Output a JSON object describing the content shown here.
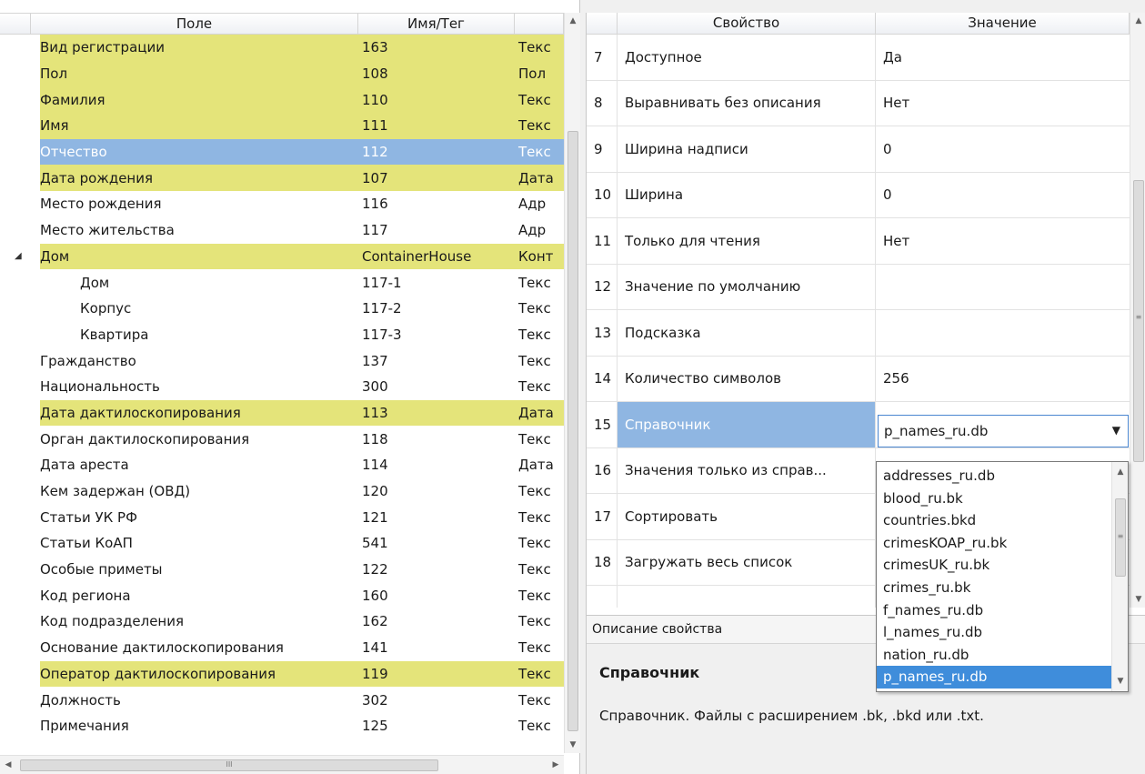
{
  "fields_panel": {
    "columns": [
      "Поле",
      "Имя/Тег",
      ""
    ],
    "rows": [
      {
        "field": "Вид регистрации",
        "tag": "163",
        "type": "Текс",
        "highlight": true,
        "level": 0
      },
      {
        "field": "Пол",
        "tag": "108",
        "type": "Пол",
        "highlight": true,
        "level": 0
      },
      {
        "field": "Фамилия",
        "tag": "110",
        "type": "Текс",
        "highlight": true,
        "level": 0
      },
      {
        "field": "Имя",
        "tag": "111",
        "type": "Текс",
        "highlight": true,
        "level": 0
      },
      {
        "field": "Отчество",
        "tag": "112",
        "type": "Текс",
        "selected": true,
        "level": 0
      },
      {
        "field": "Дата рождения",
        "tag": "107",
        "type": "Дата",
        "highlight": true,
        "level": 0
      },
      {
        "field": "Место рождения",
        "tag": "116",
        "type": "Адр",
        "level": 0
      },
      {
        "field": "Место жительства",
        "tag": "117",
        "type": "Адр",
        "level": 0
      },
      {
        "field": "Дом",
        "tag": "ContainerHouse",
        "type": "Конт",
        "highlight": true,
        "level": 0,
        "expanded": true
      },
      {
        "field": "Дом",
        "tag": "117-1",
        "type": "Текс",
        "level": 1
      },
      {
        "field": "Корпус",
        "tag": "117-2",
        "type": "Текс",
        "level": 1
      },
      {
        "field": "Квартира",
        "tag": "117-3",
        "type": "Текс",
        "level": 1
      },
      {
        "field": "Гражданство",
        "tag": "137",
        "type": "Текс",
        "level": 0
      },
      {
        "field": "Национальность",
        "tag": "300",
        "type": "Текс",
        "level": 0
      },
      {
        "field": "Дата дактилоскопирования",
        "tag": "113",
        "type": "Дата",
        "highlight": true,
        "level": 0
      },
      {
        "field": "Орган дактилоскопирования",
        "tag": "118",
        "type": "Текс",
        "level": 0
      },
      {
        "field": "Дата ареста",
        "tag": "114",
        "type": "Дата",
        "level": 0
      },
      {
        "field": "Кем задержан (ОВД)",
        "tag": "120",
        "type": "Текс",
        "level": 0
      },
      {
        "field": "Статьи УК РФ",
        "tag": "121",
        "type": "Текс",
        "level": 0
      },
      {
        "field": "Статьи КоАП",
        "tag": "541",
        "type": "Текс",
        "level": 0
      },
      {
        "field": "Особые приметы",
        "tag": "122",
        "type": "Текс",
        "level": 0
      },
      {
        "field": "Код региона",
        "tag": "160",
        "type": "Текс",
        "level": 0
      },
      {
        "field": "Код подразделения",
        "tag": "162",
        "type": "Текс",
        "level": 0
      },
      {
        "field": "Основание дактилоскопирования",
        "tag": "141",
        "type": "Текс",
        "level": 0
      },
      {
        "field": "Оператор дактилоскопирования",
        "tag": "119",
        "type": "Текс",
        "highlight": true,
        "level": 0
      },
      {
        "field": "Должность",
        "tag": "302",
        "type": "Текс",
        "level": 0
      },
      {
        "field": "Примечания",
        "tag": "125",
        "type": "Текс",
        "level": 0
      }
    ]
  },
  "properties_panel": {
    "columns": [
      "Свойство",
      "Значение"
    ],
    "rows": [
      {
        "num": "7",
        "name": "Доступное",
        "value": "Да"
      },
      {
        "num": "8",
        "name": "Выравнивать без описания",
        "value": "Нет"
      },
      {
        "num": "9",
        "name": "Ширина надписи",
        "value": "0"
      },
      {
        "num": "10",
        "name": "Ширина",
        "value": "0"
      },
      {
        "num": "11",
        "name": "Только для чтения",
        "value": "Нет"
      },
      {
        "num": "12",
        "name": "Значение по умолчанию",
        "value": ""
      },
      {
        "num": "13",
        "name": "Подсказка",
        "value": ""
      },
      {
        "num": "14",
        "name": "Количество символов",
        "value": "256"
      },
      {
        "num": "15",
        "name": "Справочник",
        "value": "",
        "selected": true
      },
      {
        "num": "16",
        "name": "Значения только из справ...",
        "value": ""
      },
      {
        "num": "17",
        "name": "Сортировать",
        "value": ""
      },
      {
        "num": "18",
        "name": "Загружать весь список",
        "value": ""
      },
      {
        "num": "",
        "name": "",
        "value": ""
      }
    ],
    "combo_value": "p_names_ru.db"
  },
  "dropdown": {
    "options": [
      "addresses_ru.db",
      "blood_ru.bk",
      "countries.bkd",
      "crimesKOAP_ru.bk",
      "crimesUK_ru.bk",
      "crimes_ru.bk",
      "f_names_ru.db",
      "l_names_ru.db",
      "nation_ru.db",
      "p_names_ru.db"
    ],
    "selected": "p_names_ru.db"
  },
  "description": {
    "header": "Описание свойства",
    "title": "Справочник",
    "text": "Справочник. Файлы с расширением .bk, .bkd или .txt."
  },
  "colors": {
    "highlight_row": "#e4e47a",
    "selected_row": "#8fb6e2",
    "dropdown_selected": "#3f8ddb"
  }
}
